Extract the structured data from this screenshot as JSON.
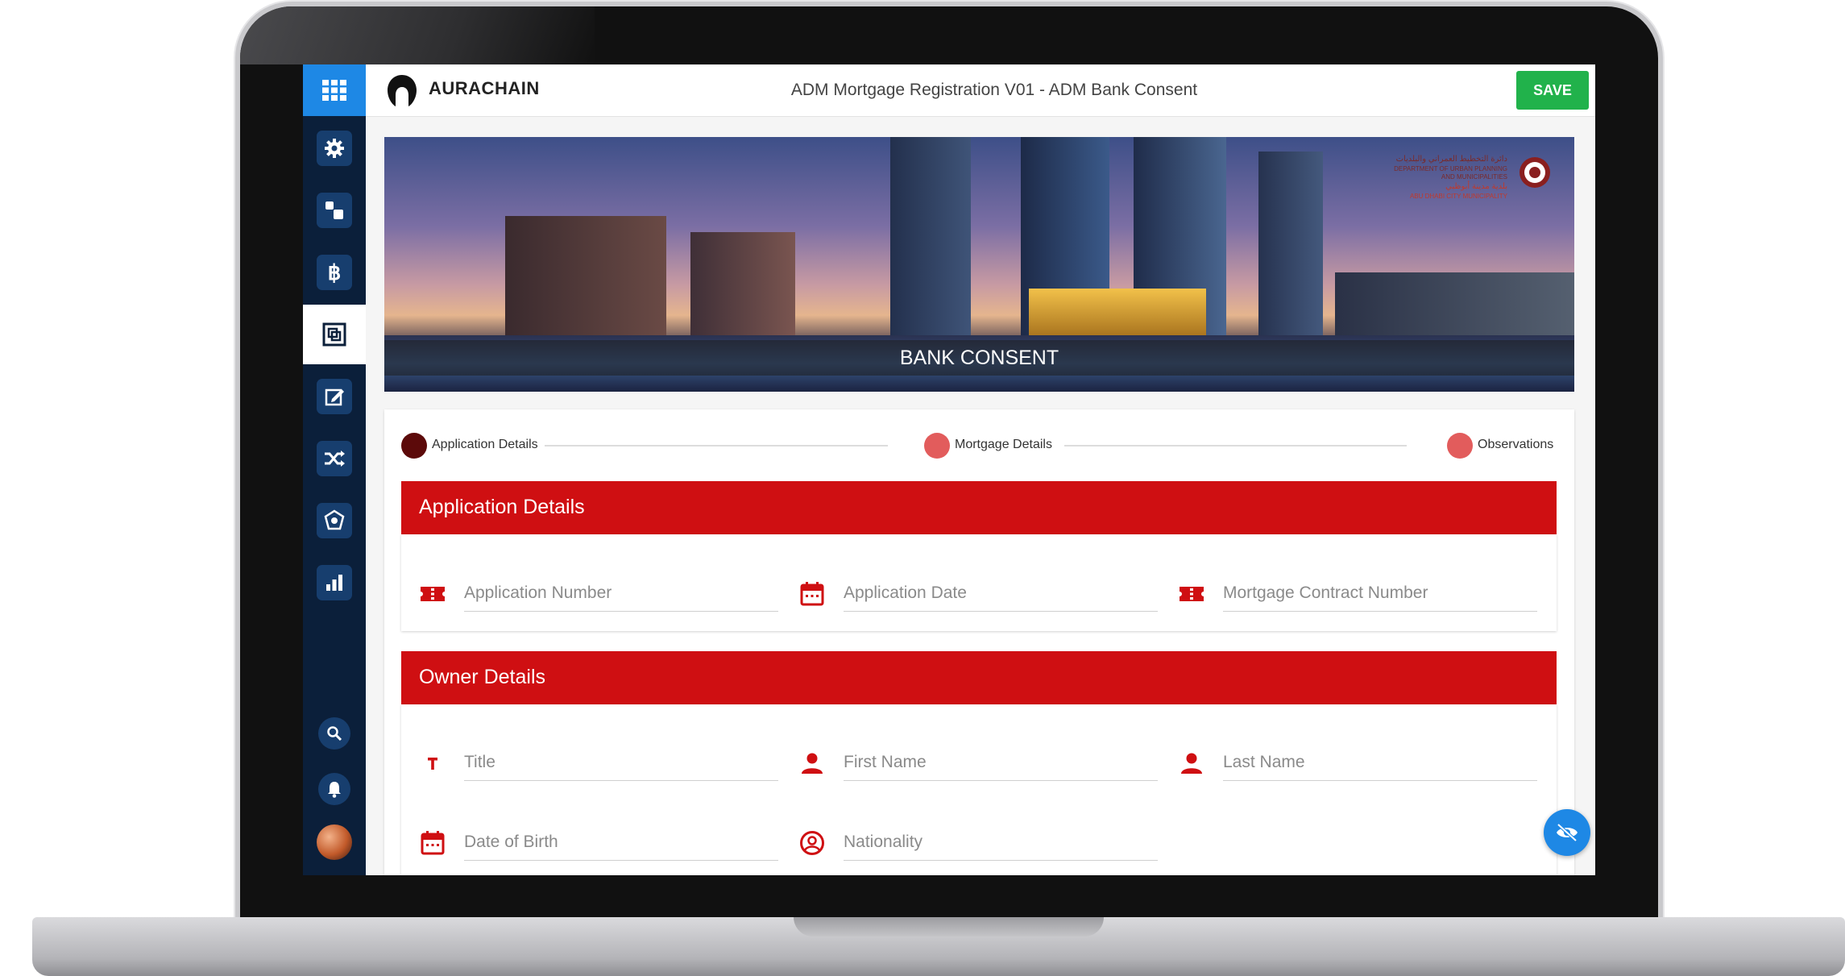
{
  "app": {
    "brand": "AURACHAIN",
    "page_title": "ADM Mortgage Registration V01  -  ADM Bank Consent",
    "save_label": "SAVE"
  },
  "sidebar": {
    "items": [
      {
        "icon": "settings-icon"
      },
      {
        "icon": "process-icon"
      },
      {
        "icon": "bitcoin-icon"
      },
      {
        "icon": "form-icon",
        "active": true
      },
      {
        "icon": "edit-icon"
      },
      {
        "icon": "shuffle-icon"
      },
      {
        "icon": "network-icon"
      },
      {
        "icon": "bar-chart-icon"
      }
    ],
    "bottom": [
      "search-icon",
      "bell-icon",
      "avatar"
    ]
  },
  "banner": {
    "caption": "BANK CONSENT",
    "org_lines": [
      "دائرة التخطيط العمراني والبلديات",
      "DEPARTMENT OF URBAN PLANNING",
      "AND MUNICIPALITIES",
      "بلدية مدينة أبوظبي",
      "ABU DHABI CITY MUNICIPALITY"
    ]
  },
  "stepper": {
    "steps": [
      {
        "label": "Application Details",
        "color": "#5c0a0a"
      },
      {
        "label": "Mortgage Details",
        "color": "#e25c5c"
      },
      {
        "label": "Observations",
        "color": "#e25c5c"
      }
    ]
  },
  "sections": {
    "application": {
      "title": "Application Details",
      "fields": {
        "application_number": {
          "placeholder": "Application Number",
          "icon": "ticket-icon"
        },
        "application_date": {
          "placeholder": "Application Date",
          "icon": "calendar-icon"
        },
        "mortgage_contract_number": {
          "placeholder": "Mortgage Contract Number",
          "icon": "ticket-icon"
        }
      }
    },
    "owner": {
      "title": "Owner Details",
      "fields": {
        "title": {
          "placeholder": "Title",
          "icon": "text-icon"
        },
        "first_name": {
          "placeholder": "First Name",
          "icon": "person-icon"
        },
        "last_name": {
          "placeholder": "Last Name",
          "icon": "person-icon"
        },
        "date_of_birth": {
          "placeholder": "Date of Birth",
          "icon": "calendar-icon"
        },
        "nationality": {
          "placeholder": "Nationality",
          "icon": "account-circle-icon"
        }
      }
    }
  },
  "colors": {
    "primary_red": "#cf0f12",
    "sidebar_bg": "#0b1f3a",
    "accent_blue": "#1e88e5",
    "save_green": "#21b24b"
  }
}
